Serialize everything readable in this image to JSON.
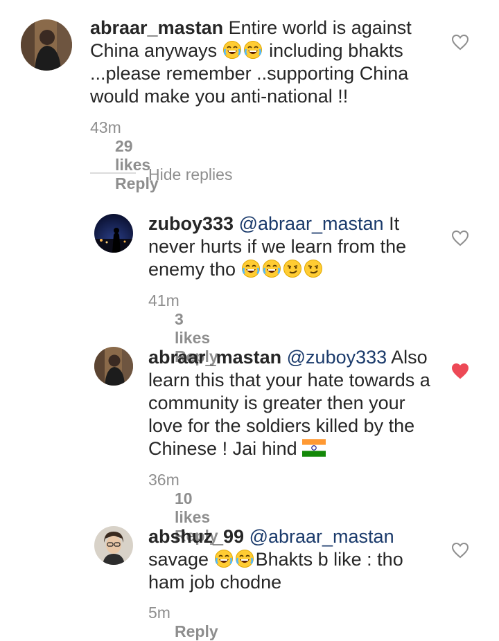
{
  "comments": [
    {
      "username": "abraar_mastan",
      "mention": "",
      "text": "Entire world is against China anyways",
      "text_after_emoji": " including bhakts ...please remember ..supporting China would make you anti-national !!",
      "time": "43m",
      "likes": "29 likes",
      "reply": "Reply",
      "liked": false
    },
    {
      "username": "zuboy333",
      "mention": "@abraar_mastan",
      "text": "It never hurts if we learn from the enemy tho",
      "time": "41m",
      "likes": "3 likes",
      "reply": "Reply",
      "liked": false
    },
    {
      "username": "abraar_mastan",
      "mention": "@zuboy333",
      "text": "Also learn this that your hate towards a community is greater  then your love for the soldiers killed by the Chinese ! Jai hind",
      "time": "36m",
      "likes": "10 likes",
      "reply": "Reply",
      "liked": true
    },
    {
      "username": "abshuz_99",
      "mention": "@abraar_mastan",
      "text": "savage",
      "text_after_emoji": "Bhakts b like : tho ham job chodne",
      "time": "5m",
      "likes": "",
      "reply": "Reply",
      "liked": false
    }
  ],
  "hide_replies": "Hide replies",
  "colors": {
    "text": "#262626",
    "mention": "#1a3a6b",
    "meta": "#8e8e8e",
    "heart_liked": "#ed4956",
    "heart_outline": "#8e8e8e"
  },
  "icons": [
    "heart-outline-icon",
    "heart-filled-icon",
    "laughing-emoji-icon",
    "smirk-emoji-icon",
    "india-flag-icon",
    "avatar"
  ]
}
